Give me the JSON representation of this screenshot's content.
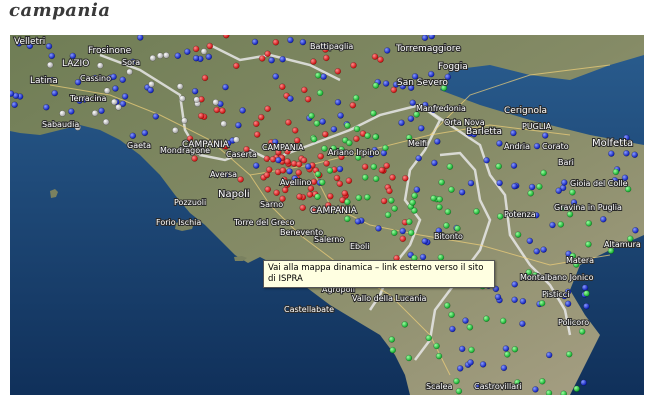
{
  "page": {
    "title": "campania"
  },
  "map": {
    "tooltip": "Vai alla mappa dinamica – link esterno verso il sito di ISPRA",
    "labels": [
      {
        "id": "latina",
        "text": "Latina"
      },
      {
        "id": "frosinone",
        "text": "Frosinone"
      },
      {
        "id": "lazio",
        "text": "LAZIO"
      },
      {
        "id": "cassino",
        "text": "Cassino"
      },
      {
        "id": "gaeta",
        "text": "Gaeta"
      },
      {
        "id": "caserta",
        "text": "Caserta"
      },
      {
        "id": "napoli",
        "text": "Napoli"
      },
      {
        "id": "pozzuoli",
        "text": "Pozzuoli"
      },
      {
        "id": "aversa",
        "text": "Aversa"
      },
      {
        "id": "forio",
        "text": "Forio Ischia"
      },
      {
        "id": "campania-1",
        "text": "CAMPANIA"
      },
      {
        "id": "campania-2",
        "text": "CAMPANIA"
      },
      {
        "id": "benevento",
        "text": "Benevento"
      },
      {
        "id": "salerno",
        "text": "Salerno"
      },
      {
        "id": "battipaglia",
        "text": "Battipaglia"
      },
      {
        "id": "torremaggiore",
        "text": "Torremaggiore"
      },
      {
        "id": "san-severo",
        "text": "San Severo"
      },
      {
        "id": "foggia",
        "text": "Foggia"
      },
      {
        "id": "manfredonia",
        "text": "Manfredonia"
      },
      {
        "id": "orta-nova",
        "text": "Orta Nova"
      },
      {
        "id": "cerignola",
        "text": "Cerignola"
      },
      {
        "id": "barletta",
        "text": "Barletta"
      },
      {
        "id": "puglia",
        "text": "PUGLIA"
      },
      {
        "id": "andria",
        "text": "Andria"
      },
      {
        "id": "corato",
        "text": "Corato"
      },
      {
        "id": "molfetta",
        "text": "Molfetta"
      },
      {
        "id": "bari",
        "text": "Bari"
      },
      {
        "id": "bitonto",
        "text": "Bitonto"
      },
      {
        "id": "potenza",
        "text": "Potenza"
      },
      {
        "id": "gravina",
        "text": "Gravina in Puglia"
      },
      {
        "id": "altamura",
        "text": "Altamura"
      },
      {
        "id": "gioia",
        "text": "Gioia del Colle"
      },
      {
        "id": "acquaviva",
        "text": "Acquaviva delle Fonti"
      },
      {
        "id": "agropoli",
        "text": "Agropoli"
      },
      {
        "id": "castellabate",
        "text": "Castellabate"
      },
      {
        "id": "vallo",
        "text": "Vallo della Lucania"
      },
      {
        "id": "scalea",
        "text": "Scalea"
      },
      {
        "id": "castrovillari",
        "text": "Castrovillari"
      },
      {
        "id": "policoro",
        "text": "Policoro"
      },
      {
        "id": "matera",
        "text": "Matera"
      },
      {
        "id": "melfi",
        "text": "Melfi"
      },
      {
        "id": "ariano",
        "text": "Ariano Irpino"
      },
      {
        "id": "avellino",
        "text": "Avellino"
      },
      {
        "id": "sora",
        "text": "Sora"
      },
      {
        "id": "terracina",
        "text": "Terracina"
      },
      {
        "id": "sabaudia",
        "text": "Sabaudia"
      },
      {
        "id": "velletri",
        "text": "Velletri"
      },
      {
        "id": "mondragone",
        "text": "Mondragone"
      },
      {
        "id": "torre-greco",
        "text": "Torre del Greco"
      },
      {
        "id": "sarno",
        "text": "Sarno"
      },
      {
        "id": "eboli",
        "text": "Eboli"
      },
      {
        "id": "montalbano",
        "text": "Montalbano Jonico"
      },
      {
        "id": "pisticci",
        "text": "Pisticci"
      }
    ]
  }
}
